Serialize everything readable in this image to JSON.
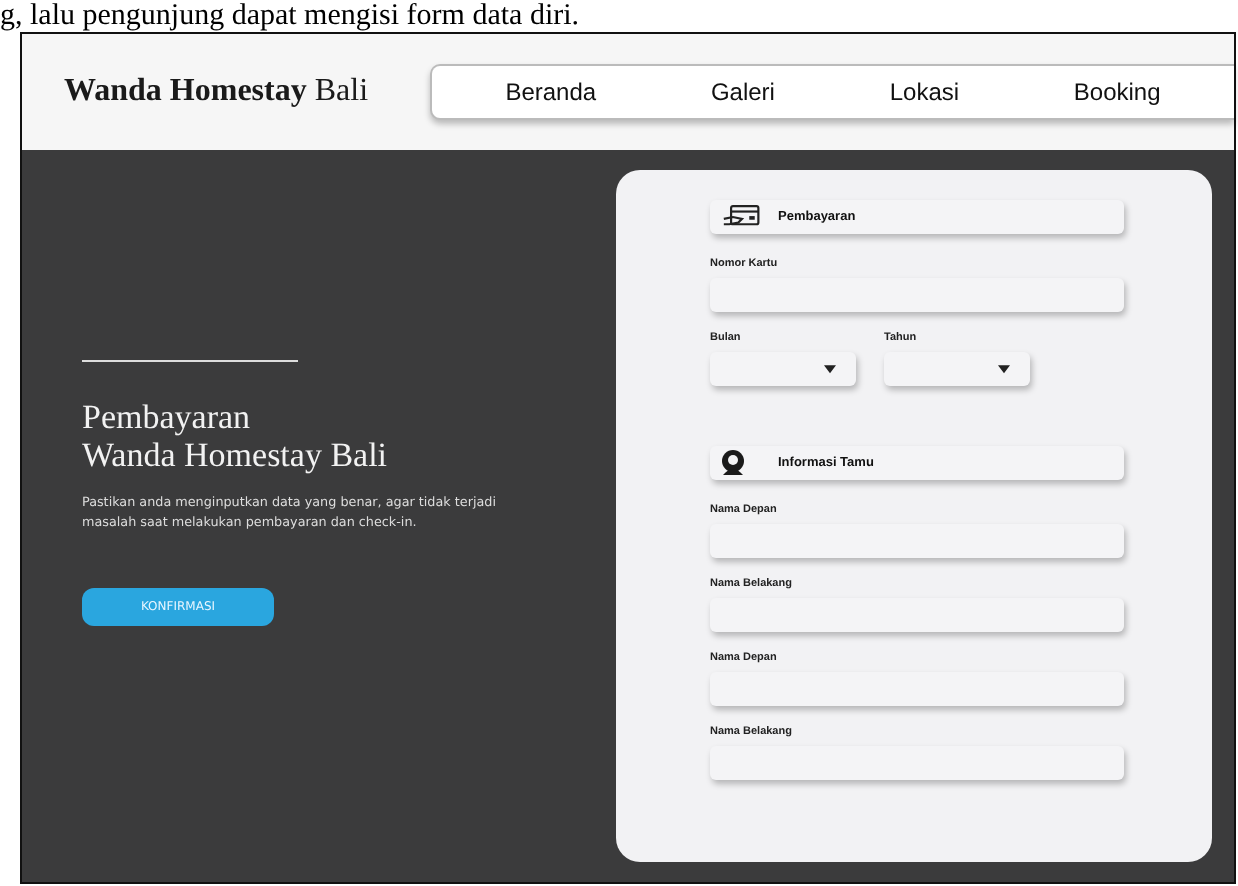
{
  "caption": "g, lalu pengunjung dapat mengisi form data diri.",
  "header": {
    "brand": "**Wanda Homestay** Bali",
    "nav": [
      {
        "label": "Beranda"
      },
      {
        "label": "Galeri"
      },
      {
        "label": "Lokasi"
      },
      {
        "label": "Booking"
      }
    ]
  },
  "hero": {
    "title_lines": [
      "Pembayaran",
      "Wanda Homestay Bali"
    ],
    "text": "Pastikan anda menginputkan data yang benar, agar tidak terjadi masalah saat melakukan pembayaran dan check-in.",
    "button": "KONFIRMASI"
  },
  "form": [
    {
      "kind": "payment",
      "title": "Pembayaran"
    },
    {
      "kind": "field",
      "label": "Nomor Kartu"
    },
    {
      "kind": "selects",
      "selects": [
        {
          "label": "Bulan"
        },
        {
          "label": "Tahun"
        }
      ]
    },
    {
      "kind": "guest",
      "title": "Informasi Tamu"
    },
    {
      "kind": "field",
      "label": "Nama Depan"
    },
    {
      "kind": "field",
      "label": "Nama Belakang"
    },
    {
      "kind": "field",
      "label": "Nama Depan"
    },
    {
      "kind": "field",
      "label": "Nama Belakang"
    }
  ]
}
